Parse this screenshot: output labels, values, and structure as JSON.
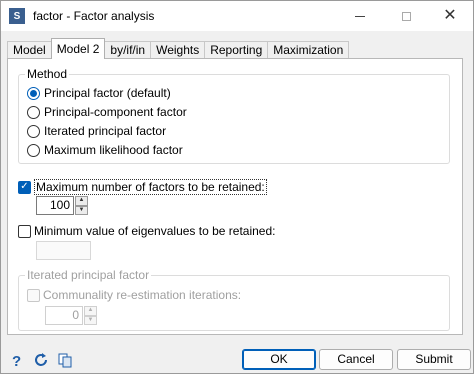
{
  "window": {
    "title": "factor - Factor analysis",
    "icon": "stata-icon"
  },
  "tabs": [
    {
      "label": "Model",
      "active": false
    },
    {
      "label": "Model 2",
      "active": true
    },
    {
      "label": "by/if/in",
      "active": false
    },
    {
      "label": "Weights",
      "active": false
    },
    {
      "label": "Reporting",
      "active": false
    },
    {
      "label": "Maximization",
      "active": false
    }
  ],
  "method": {
    "legend": "Method",
    "options": [
      {
        "label": "Principal factor (default)",
        "selected": true
      },
      {
        "label": "Principal-component factor",
        "selected": false
      },
      {
        "label": "Iterated principal factor",
        "selected": false
      },
      {
        "label": "Maximum likelihood factor",
        "selected": false
      }
    ]
  },
  "max_factors": {
    "label": "Maximum number of factors to be retained:",
    "checked": true,
    "value": "100"
  },
  "min_eigen": {
    "label": "Minimum value of eigenvalues to be retained:",
    "checked": false,
    "value": ""
  },
  "iterated": {
    "legend": "Iterated principal factor",
    "check_label": "Communality re-estimation iterations:",
    "checked": false,
    "value": "0"
  },
  "footer": {
    "ok": "OK",
    "cancel": "Cancel",
    "submit": "Submit"
  },
  "colors": {
    "accent": "#005fb8"
  }
}
